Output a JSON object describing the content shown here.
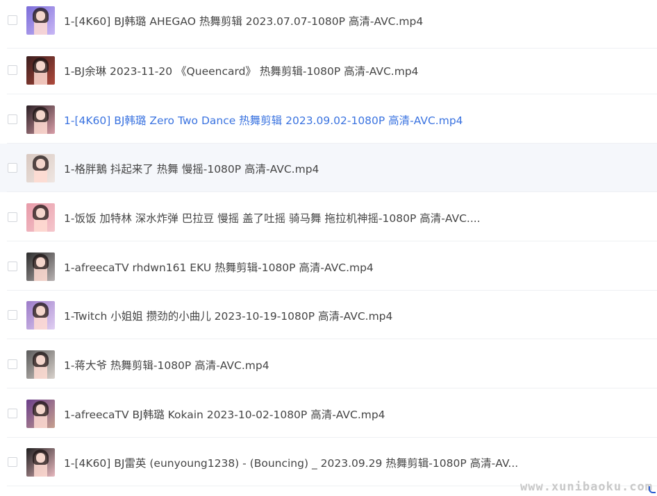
{
  "file_list": {
    "items": [
      {
        "name": "1-[4K60] BJ韩璐 AHEGAO 热舞剪辑 2023.07.07-1080P 高清-AVC.mp4",
        "state": "normal",
        "thumb_colors": [
          "#7a6cd9",
          "#c9b7f5"
        ]
      },
      {
        "name": "1-BJ余琳 2023-11-20 《Queencard》 热舞剪辑-1080P 高清-AVC.mp4",
        "state": "normal",
        "thumb_colors": [
          "#3a1d1d",
          "#b04a3c"
        ]
      },
      {
        "name": "1-[4K60] BJ韩璐 Zero Two Dance 热舞剪辑 2023.09.02-1080P 高清-AVC.mp4",
        "state": "active",
        "thumb_colors": [
          "#2a1f24",
          "#d99ea8"
        ]
      },
      {
        "name": "1-格胖鵝 抖起来了 热舞 慢摇-1080P 高清-AVC.mp4",
        "state": "hover",
        "thumb_colors": [
          "#d8c8c0",
          "#efe6e2"
        ]
      },
      {
        "name": "1-饭饭 加特林 深水炸弹 巴拉豆 慢摇 盖了吐摇 骑马舞 拖拉机神摇-1080P 高清-AVC....",
        "state": "normal",
        "thumb_colors": [
          "#e79aa8",
          "#f5c6cc"
        ]
      },
      {
        "name": "1-afreecaTV rhdwn161 EKU 热舞剪辑-1080P 高清-AVC.mp4",
        "state": "normal",
        "thumb_colors": [
          "#2c2c2c",
          "#b9b3b3"
        ]
      },
      {
        "name": "1-Twitch 小姐姐 攒劲的小曲儿 2023-10-19-1080P 高清-AVC.mp4",
        "state": "normal",
        "thumb_colors": [
          "#9b7ac8",
          "#e0cff2"
        ]
      },
      {
        "name": "1-蒋大爷 热舞剪辑-1080P 高清-AVC.mp4",
        "state": "normal",
        "thumb_colors": [
          "#5a5a5a",
          "#d9d2cc"
        ]
      },
      {
        "name": "1-afreecaTV BJ韩璐 Kokain 2023-10-02-1080P 高清-AVC.mp4",
        "state": "normal",
        "thumb_colors": [
          "#6a3d8a",
          "#c7a18f"
        ]
      },
      {
        "name": "1-[4K60] BJ雷英 (eunyoung1238) - (Bouncing) _ 2023.09.29 热舞剪辑-1080P 高清-AV...",
        "state": "normal",
        "thumb_colors": [
          "#1e1e1e",
          "#e8b9c0"
        ]
      }
    ]
  },
  "watermark": "www.xunibaoku.com",
  "colors": {
    "active_text": "#3a73e0",
    "text": "#454545",
    "hover_bg": "#f5f7fb",
    "divider": "#eef0f3"
  }
}
